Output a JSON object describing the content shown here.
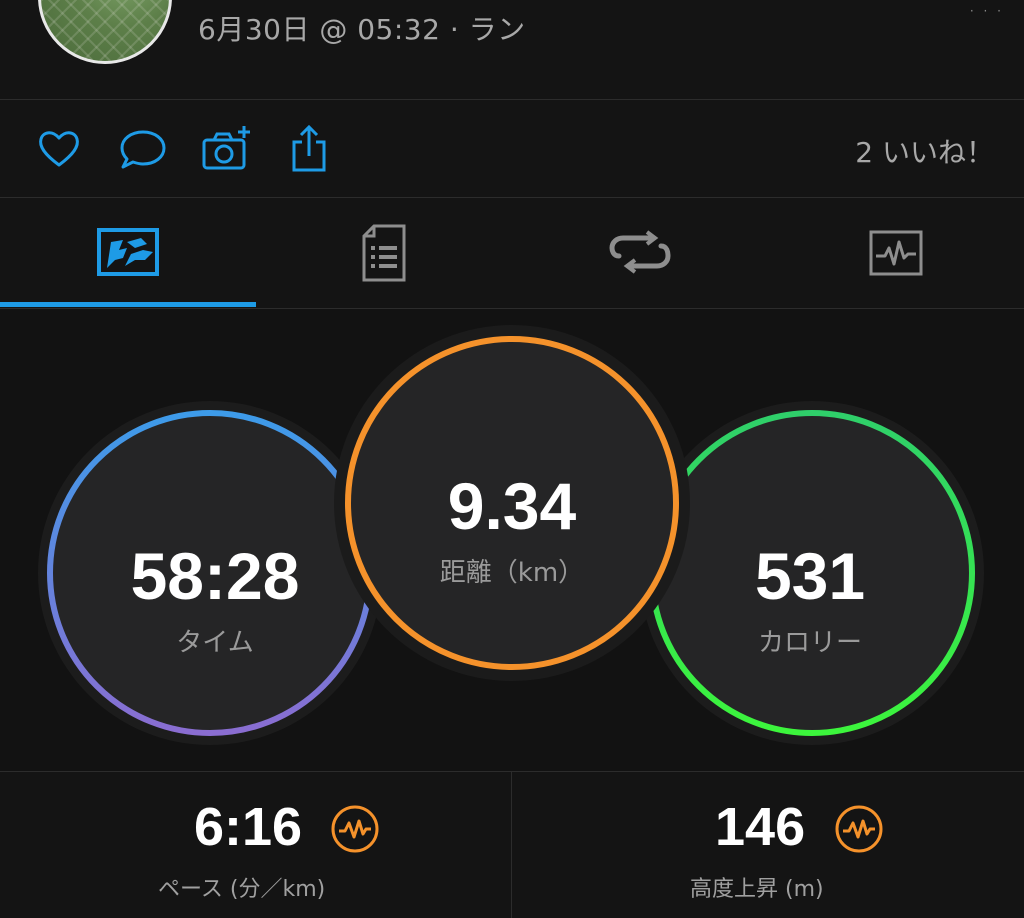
{
  "header": {
    "date_line": "6月30日 @ 05:32 · ラン",
    "status_dots": "· · ·"
  },
  "actions": {
    "likes_text": "2 いいね！",
    "icons": [
      "heart-icon",
      "comment-icon",
      "camera-add-icon",
      "share-icon"
    ]
  },
  "tabs": {
    "items": [
      {
        "name": "overview",
        "icon": "overview-icon",
        "active": true
      },
      {
        "name": "details",
        "icon": "document-list-icon",
        "active": false
      },
      {
        "name": "laps",
        "icon": "repeat-icon",
        "active": false
      },
      {
        "name": "charts",
        "icon": "chart-icon",
        "active": false
      }
    ]
  },
  "gauges": {
    "time": {
      "value": "58:28",
      "label": "タイム"
    },
    "distance": {
      "value": "9.34",
      "label": "距離（km）"
    },
    "calories": {
      "value": "531",
      "label": "カロリー"
    }
  },
  "stats": {
    "pace": {
      "value": "6:16",
      "label": "ペース (分／km)",
      "icon": "pulse-chart-icon"
    },
    "elevation": {
      "value": "146",
      "label": "高度上昇 (m)",
      "icon": "pulse-chart-icon"
    }
  },
  "colors": {
    "accent_blue": "#1e9be6",
    "ring_time_start": "#3d9be9",
    "ring_time_end": "#8a6dd1",
    "ring_distance": "#f5922b",
    "ring_calories_start": "#2fcf6a",
    "ring_calories_end": "#3cf53c",
    "stat_icon": "#f5922b"
  }
}
